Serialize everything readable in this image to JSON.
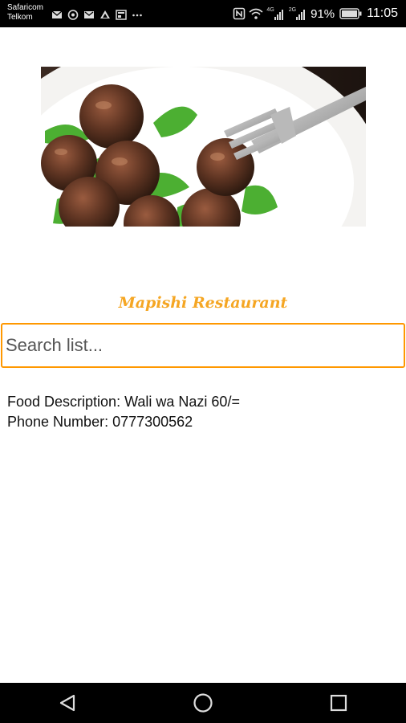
{
  "status_bar": {
    "carrier_line1": "Safaricom",
    "carrier_line2": "Telkom",
    "notification_icons": [
      "mail-icon",
      "whatsapp-icon",
      "gmail-icon",
      "drive-icon",
      "news-icon",
      "more-icon"
    ],
    "network_labels": [
      "4G",
      "2G"
    ],
    "battery_percent": "91%",
    "time": "11:05"
  },
  "hero": {
    "alt": "meatballs-on-plate-image"
  },
  "restaurant": {
    "title": "Mapishi Restaurant"
  },
  "search": {
    "placeholder": "Search list..."
  },
  "results": [
    {
      "food_description": "Food Description: Wali wa Nazi 60/=",
      "phone_number": "Phone Number: 0777300562"
    }
  ],
  "nav": {
    "buttons": [
      "back-button",
      "home-button",
      "recents-button"
    ]
  },
  "colors": {
    "accent": "#ff9800",
    "title": "#f5a623",
    "bars": "#000000"
  }
}
